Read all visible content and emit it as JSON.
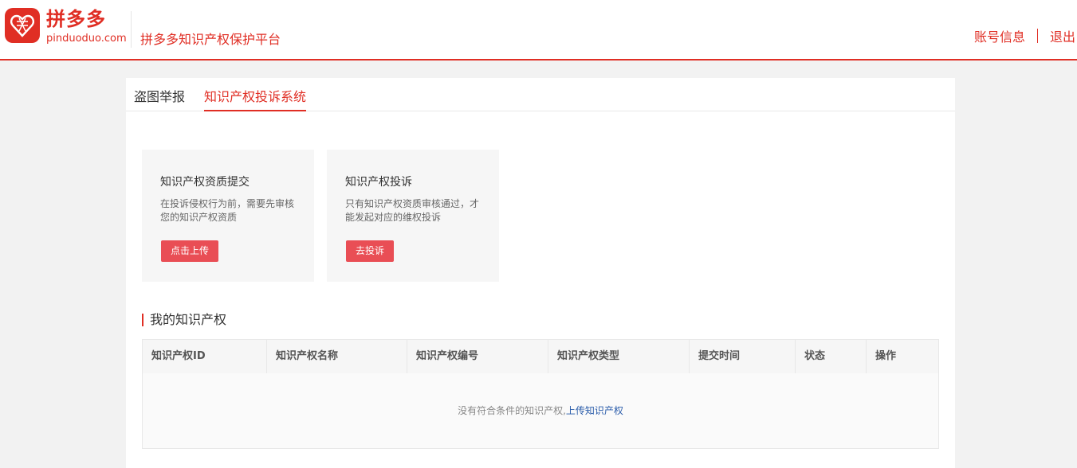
{
  "header": {
    "logo_cn": "拼多多",
    "logo_en": "pinduoduo.com",
    "platform_title": "拼多多知识产权保护平台",
    "account_info": "账号信息",
    "logout": "退出"
  },
  "tabs": [
    {
      "label": "盗图举报"
    },
    {
      "label": "知识产权投诉系统"
    }
  ],
  "cards": [
    {
      "title": "知识产权资质提交",
      "desc": "在投诉侵权行为前，需要先审核您的知识产权资质",
      "button": "点击上传"
    },
    {
      "title": "知识产权投诉",
      "desc": "只有知识产权资质审核通过，才能发起对应的维权投诉",
      "button": "去投诉"
    }
  ],
  "section_title": "我的知识产权",
  "table": {
    "columns": [
      "知识产权ID",
      "知识产权名称",
      "知识产权编号",
      "知识产权类型",
      "提交时间",
      "状态",
      "操作"
    ],
    "empty_text": "没有符合条件的知识产权,",
    "empty_link": "上传知识产权"
  },
  "colors": {
    "brand": "#e02e24",
    "button": "#e94e55",
    "link": "#2a5caa"
  }
}
